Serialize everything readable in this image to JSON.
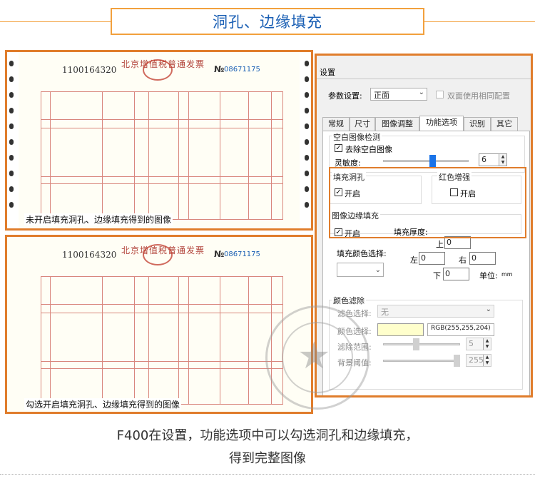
{
  "header": {
    "title": "洞孔、边缘填充"
  },
  "invoice": {
    "number": "1100164320",
    "title": "北京增值税普通发票",
    "no_prefix": "№",
    "serial": "08671175"
  },
  "captions": {
    "top": "未开启填充洞孔、边缘填充得到的图像",
    "bottom": "勾选开启填充洞孔、边缘填充得到的图像"
  },
  "dialog": {
    "title": "设置",
    "param_label": "参数设置:",
    "param_value": "正面",
    "duplex_label": "双面使用相同配置",
    "tabs": [
      "常规",
      "尺寸",
      "图像调整",
      "功能选项",
      "识别",
      "其它"
    ],
    "active_tab": "功能选项",
    "blank_detect": {
      "title": "空白图像检测",
      "remove_label": "去除空白图像",
      "remove_checked": true,
      "sensitivity_label": "灵敏度:",
      "sensitivity_value": "6"
    },
    "fill_holes": {
      "title": "填充洞孔",
      "enable_label": "开启",
      "checked": true
    },
    "red_enhance": {
      "title": "红色增强",
      "enable_label": "开启",
      "checked": false
    },
    "edge_fill": {
      "title": "图像边缘填充",
      "enable_label": "开启",
      "checked": true,
      "thickness_label": "填充厚度:",
      "top_label": "上",
      "top_value": "0",
      "left_label": "左",
      "left_value": "0",
      "right_label": "右",
      "right_value": "0",
      "bottom_label": "下",
      "bottom_value": "0",
      "unit_label": "单位:",
      "unit_value": "mm",
      "color_label": "填充颜色选择:"
    },
    "color_filter": {
      "title": "颜色滤除",
      "filter_label": "滤色选择:",
      "filter_value": "无",
      "color_label": "颜色选择:",
      "color_value": "RGB(255,255,204)",
      "swatch_color": "#ffffcc",
      "range_label": "滤除范围:",
      "range_value": "5",
      "bg_threshold_label": "背景阈值:",
      "bg_threshold_value": "255"
    }
  },
  "footer": {
    "line1": "F400在设置，功能选项中可以勾选洞孔和边缘填充，",
    "line2": "得到完整图像"
  },
  "colors": {
    "accent": "#e07d2c",
    "title_blue": "#1a5fb4",
    "checkbox_active": "#1a73e8"
  }
}
